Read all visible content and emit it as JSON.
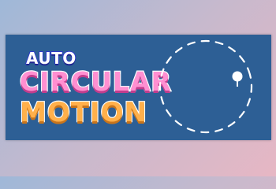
{
  "game": {
    "title_line1": "AUTO",
    "title_line2": "CIRCULAR",
    "title_line3": "MOTION"
  },
  "colors": {
    "banner": "#2d5f95",
    "auto_fill": "#ffffff",
    "auto_outline": "#2c2fd6",
    "circular_fill": "#ff8fd1",
    "motion_fill": "#ffb04b",
    "orbit": "#ffffff"
  },
  "icons": {
    "orbit_path": "dashed-circle-icon",
    "orbit_ball": "ball-icon"
  }
}
